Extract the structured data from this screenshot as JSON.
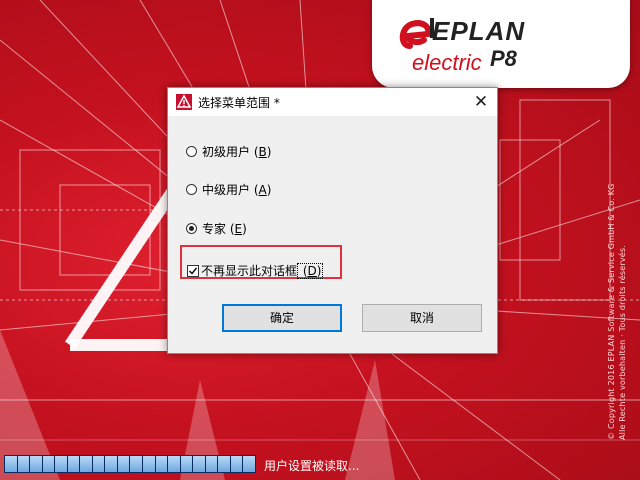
{
  "splash": {
    "logo": {
      "brand": "EPLAN",
      "product": "electric",
      "version": "P8"
    },
    "copyright_line1": "© Copyright 2016 EPLAN Software & Service GmbH & Co. KG",
    "copyright_line2": "Alle Rechte vorbehalten · Tous droits réservés.",
    "status_text": "用户设置被读取...",
    "progress_segments": 20
  },
  "dialog": {
    "title": "选择菜单范围 *",
    "close_glyph": "✕",
    "options": [
      {
        "label": "初级用户",
        "key": "B",
        "checked": false
      },
      {
        "label": "中级用户",
        "key": "A",
        "checked": false
      },
      {
        "label": "专家",
        "key": "E",
        "checked": true
      }
    ],
    "checkbox": {
      "label": "不再显示此对话框",
      "key": "D",
      "checked": true
    },
    "ok_label": "确定",
    "cancel_label": "取消"
  },
  "colors": {
    "splash_red": "#c8102e",
    "highlight": "#e0323c",
    "focus": "#0078d7"
  }
}
